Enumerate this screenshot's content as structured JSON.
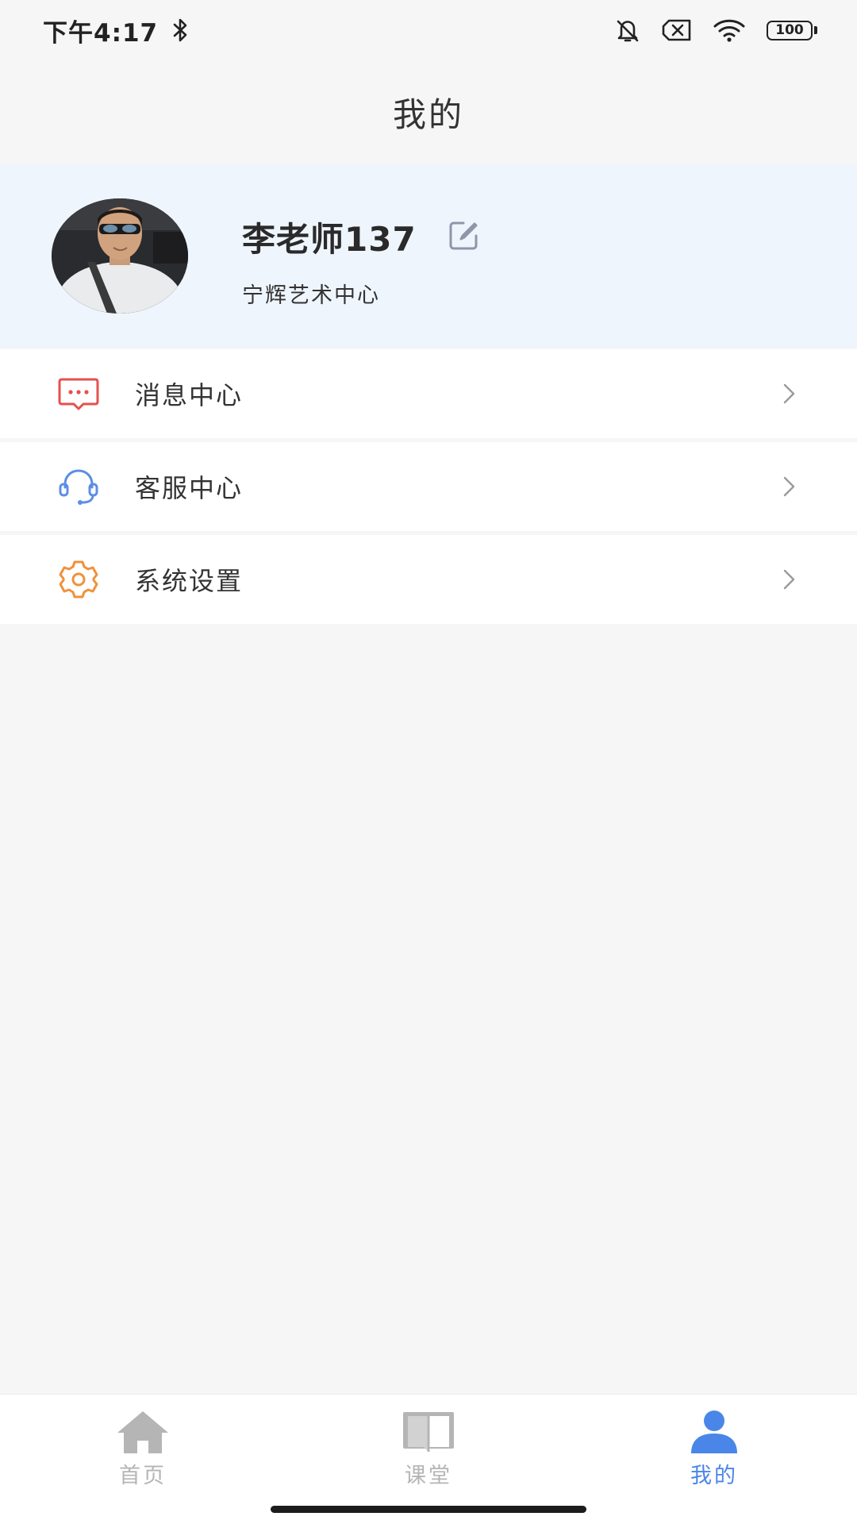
{
  "status_bar": {
    "time": "下午4:17",
    "battery": "100",
    "icons": [
      "bluetooth-icon",
      "bell-muted-icon",
      "no-sim-icon",
      "wifi-icon",
      "battery-icon"
    ]
  },
  "header": {
    "title": "我的"
  },
  "profile": {
    "name": "李老师137",
    "organization": "宁辉艺术中心"
  },
  "menu": {
    "items": [
      {
        "label": "消息中心",
        "icon": "message-icon",
        "color": "#e5514f"
      },
      {
        "label": "客服中心",
        "icon": "headset-icon",
        "color": "#5b8ee6"
      },
      {
        "label": "系统设置",
        "icon": "gear-icon",
        "color": "#f0913a"
      }
    ]
  },
  "tab_bar": {
    "tabs": [
      {
        "label": "首页",
        "icon": "home-icon",
        "active": false
      },
      {
        "label": "课堂",
        "icon": "book-icon",
        "active": false
      },
      {
        "label": "我的",
        "icon": "user-icon",
        "active": true
      }
    ],
    "active_color": "#4a86e8",
    "inactive_color": "#b5b5b5"
  }
}
